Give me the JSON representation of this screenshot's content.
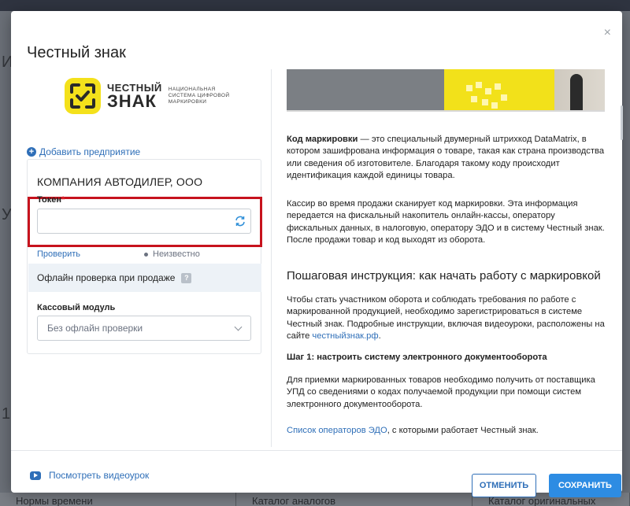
{
  "background": {
    "frag_1": "И",
    "frag_2": "У",
    "frag_3": "1",
    "bottom_tabs": [
      "Нормы времени",
      "Каталог аналогов",
      "Каталог оригинальных"
    ]
  },
  "modal": {
    "title": "Честный знак",
    "close_icon": "×"
  },
  "logo": {
    "line1": "ЧЕСТНЫЙ",
    "line2": "ЗНАК",
    "sub1": "НАЦИОНАЛЬНАЯ",
    "sub2": "СИСТЕМА ЦИФРОВОЙ",
    "sub3": "МАРКИРОВКИ",
    "color": "#f4e11b"
  },
  "left": {
    "add_company": "Добавить предприятие",
    "company_name": "КОМПАНИЯ АВТОДИЛЕР, ООО",
    "token_label": "Токен",
    "token_required_mark": "*",
    "token_value": "",
    "check_link": "Проверить",
    "status_text": "Неизвестно",
    "offline_check": "Офлайн проверка при продаже",
    "help_icon": "?",
    "kassa_label": "Кассовый модуль",
    "kassa_selected": "Без офлайн проверки"
  },
  "right": {
    "p1_bold": "Код маркировки",
    "p1_rest": " — это специальный двумерный штрихкод DataMatrix, в котором зашифрована информация о товаре, такая как страна производства или сведения об изготовителе. Благодаря такому коду происходит идентификация каждой единицы товара.",
    "p2": "Кассир во время продажи сканирует код маркировки. Эта информация передается на фискальный накопитель онлайн-кассы, оператору фискальных данных, в налоговую, оператору ЭДО и в систему Честный знак. После продажи товар и код выходят из оборота.",
    "heading": "Пошаговая инструкция: как начать работу с маркировкой",
    "p3_text": "Чтобы стать участником оборота и соблюдать требования по работе с маркированной продукцией, необходимо зарегистрироваться в системе Честный знак. Подробные инструкции, включая видеоуроки, расположены на сайте ",
    "p3_link": "честныйзнак.рф",
    "p3_end": ".",
    "step1": "Шаг 1: настроить систему электронного документооборота",
    "p4": "Для приемки маркированных товаров необходимо получить от поставщика УПД со сведениями о кодах получаемой продукции при помощи систем электронного документооборота.",
    "p5_link": "Список операторов ЭДО",
    "p5_rest": ", с которыми работает Честный знак."
  },
  "footer": {
    "video_link": "Посмотреть видеоурок",
    "cancel": "ОТМЕНИТЬ",
    "save": "СОХРАНИТЬ"
  },
  "colors": {
    "accent": "#2d8ce3",
    "link": "#2f6fb8",
    "highlight_border": "#c7131d",
    "required": "#d9232e"
  }
}
